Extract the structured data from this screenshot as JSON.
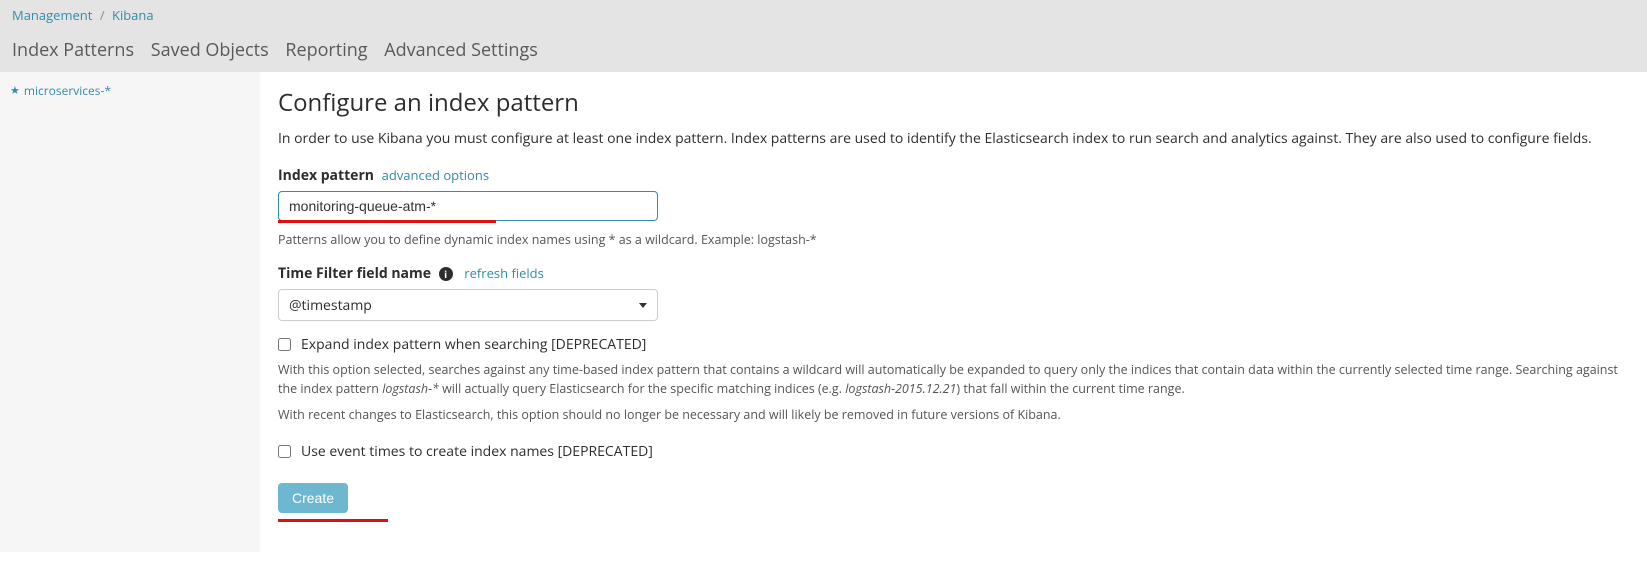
{
  "breadcrumb": {
    "root": "Management",
    "current": "Kibana"
  },
  "tabs": {
    "index_patterns": "Index Patterns",
    "saved_objects": "Saved Objects",
    "reporting": "Reporting",
    "advanced_settings": "Advanced Settings"
  },
  "sidebar": {
    "items": [
      {
        "label": "microservices-*"
      }
    ]
  },
  "main": {
    "title": "Configure an index pattern",
    "intro": "In order to use Kibana you must configure at least one index pattern. Index patterns are used to identify the Elasticsearch index to run search and analytics against. They are also used to configure fields.",
    "index_pattern_label": "Index pattern",
    "advanced_options": "advanced options",
    "index_pattern_value": "monitoring-queue-atm-*",
    "pattern_help": "Patterns allow you to define dynamic index names using * as a wildcard. Example: logstash-*",
    "time_filter_label": "Time Filter field name",
    "refresh_fields": "refresh fields",
    "time_filter_value": "@timestamp",
    "expand_checkbox_label": "Expand index pattern when searching [DEPRECATED]",
    "expand_help_1_pre": "With this option selected, searches against any time-based index pattern that contains a wildcard will automatically be expanded to query only the indices that contain data within the currently selected time range. Searching against the index pattern ",
    "expand_help_1_em1": "logstash-*",
    "expand_help_1_mid": " will actually query Elasticsearch for the specific matching indices (e.g. ",
    "expand_help_1_em2": "logstash-2015.12.21",
    "expand_help_1_post": ") that fall within the current time range.",
    "expand_help_2": "With recent changes to Elasticsearch, this option should no longer be necessary and will likely be removed in future versions of Kibana.",
    "event_times_checkbox_label": "Use event times to create index names [DEPRECATED]",
    "create_button": "Create"
  }
}
